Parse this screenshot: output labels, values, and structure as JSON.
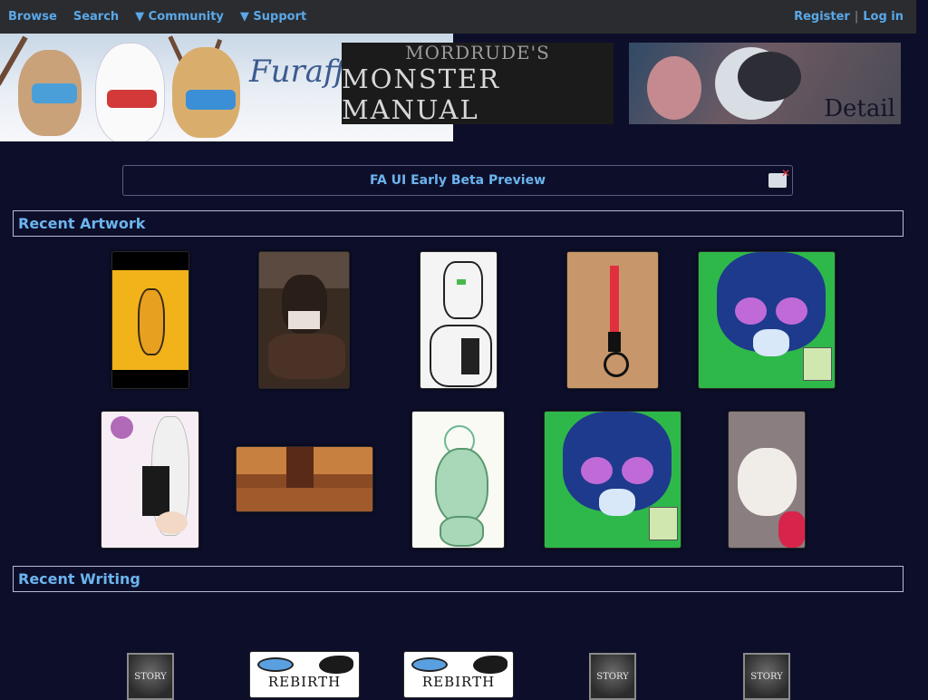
{
  "nav": {
    "browse": "Browse",
    "search": "Search",
    "community": "▼ Community",
    "support": "▼ Support",
    "register": "Register",
    "separator": "|",
    "login": "Log in"
  },
  "banners": {
    "main_title": "Furaffin",
    "ad1_line1": "MORDRUDE'S",
    "ad1_line2": "MONSTER MANUAL",
    "ad2_label": "Detail"
  },
  "beta_notice": "FA UI Early Beta Preview",
  "sections": {
    "artwork": "Recent Artwork",
    "writing": "Recent Writing"
  },
  "writing_items": [
    {
      "label": "STORY"
    },
    {
      "label": "REBIRTH"
    },
    {
      "label": "REBIRTH"
    },
    {
      "label": "STORY"
    },
    {
      "label": "STORY"
    }
  ],
  "colors": {
    "background": "#0d0f2a",
    "nav_bg": "#2a2c30",
    "link": "#5aa8e8",
    "heading": "#6cb4ee"
  }
}
